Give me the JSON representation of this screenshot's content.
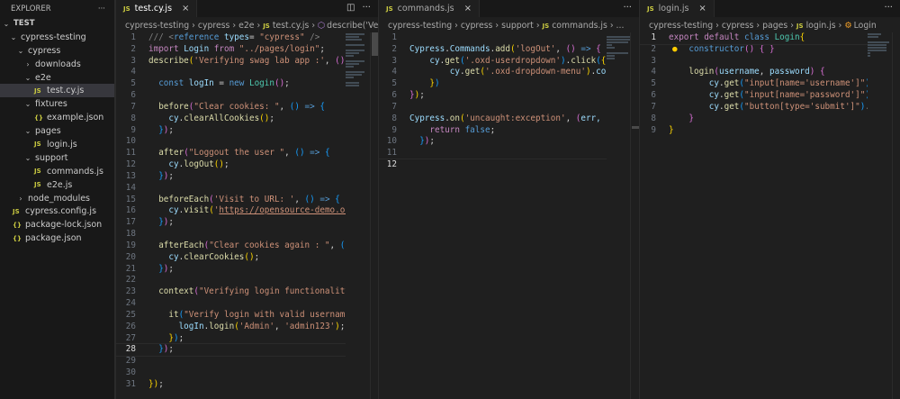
{
  "explorer": {
    "title": "EXPLORER",
    "more": "···",
    "items": [
      {
        "label": "TEST",
        "depth": 0,
        "type": "folder",
        "bold": true
      },
      {
        "label": "cypress-testing",
        "depth": 1,
        "type": "folder"
      },
      {
        "label": "cypress",
        "depth": 2,
        "type": "folder"
      },
      {
        "label": "downloads",
        "depth": 3,
        "type": "folder-closed"
      },
      {
        "label": "e2e",
        "depth": 3,
        "type": "folder"
      },
      {
        "label": "test.cy.js",
        "depth": 4,
        "type": "js",
        "selected": true
      },
      {
        "label": "fixtures",
        "depth": 3,
        "type": "folder"
      },
      {
        "label": "example.json",
        "depth": 4,
        "type": "json"
      },
      {
        "label": "pages",
        "depth": 3,
        "type": "folder"
      },
      {
        "label": "login.js",
        "depth": 4,
        "type": "js"
      },
      {
        "label": "support",
        "depth": 3,
        "type": "folder"
      },
      {
        "label": "commands.js",
        "depth": 4,
        "type": "js"
      },
      {
        "label": "e2e.js",
        "depth": 4,
        "type": "js"
      },
      {
        "label": "node_modules",
        "depth": 2,
        "type": "folder-closed"
      },
      {
        "label": "cypress.config.js",
        "depth": 1,
        "type": "js"
      },
      {
        "label": "package-lock.json",
        "depth": 1,
        "type": "json"
      },
      {
        "label": "package.json",
        "depth": 1,
        "type": "json"
      }
    ]
  },
  "icons": {
    "js": "JS",
    "json": "{}",
    "close": "×",
    "more": "···",
    "split": "◫",
    "chev_open": "⌄",
    "chev_closed": "›",
    "bulb": "💡"
  },
  "editors": [
    {
      "tab": "test.cy.js",
      "crumbs": [
        "cypress-testing",
        "cypress",
        "e2e",
        "test.cy.js",
        "describe('Verifying s"
      ],
      "active_line": 28,
      "lines": [
        [
          [
            "/// ",
            "cm"
          ],
          [
            "<",
            "cm"
          ],
          [
            "reference ",
            "key"
          ],
          [
            "types",
            "var"
          ],
          [
            "= ",
            "p"
          ],
          [
            "\"cypress\"",
            "str"
          ],
          [
            " />",
            "cm"
          ]
        ],
        [
          [
            "import ",
            "ctl"
          ],
          [
            "Login ",
            "var"
          ],
          [
            "from ",
            "ctl"
          ],
          [
            "\"../pages/login\"",
            "str"
          ],
          [
            ";",
            "p"
          ]
        ],
        [
          [
            "describe",
            "fn"
          ],
          [
            "(",
            "b1"
          ],
          [
            "'Verifying swag lab app :'",
            "str"
          ],
          [
            ", ",
            "p"
          ],
          [
            "()",
            "b2"
          ],
          [
            " ",
            "p"
          ]
        ],
        [],
        [
          [
            "  const ",
            "key"
          ],
          [
            "logIn",
            "var"
          ],
          [
            " = ",
            "p"
          ],
          [
            "new ",
            "key"
          ],
          [
            "Login",
            "cls"
          ],
          [
            "()",
            "b2"
          ],
          [
            ";",
            "p"
          ]
        ],
        [],
        [
          [
            "  before",
            "fn"
          ],
          [
            "(",
            "b2"
          ],
          [
            "\"Clear cookies: \"",
            "str"
          ],
          [
            ", ",
            "p"
          ],
          [
            "()",
            "b3"
          ],
          [
            " => ",
            "key"
          ],
          [
            "{",
            "b3"
          ]
        ],
        [
          [
            "    cy",
            "var"
          ],
          [
            ".",
            "p"
          ],
          [
            "clearAllCookies",
            "fn"
          ],
          [
            "()",
            "b1"
          ],
          [
            ";",
            "p"
          ]
        ],
        [
          [
            "  }",
            "b3"
          ],
          [
            ")",
            "b2"
          ],
          [
            ";",
            "p"
          ]
        ],
        [],
        [
          [
            "  after",
            "fn"
          ],
          [
            "(",
            "b2"
          ],
          [
            "\"Loggout the user \"",
            "str"
          ],
          [
            ", ",
            "p"
          ],
          [
            "()",
            "b3"
          ],
          [
            " => ",
            "key"
          ],
          [
            "{",
            "b3"
          ]
        ],
        [
          [
            "    cy",
            "var"
          ],
          [
            ".",
            "p"
          ],
          [
            "logOut",
            "fn"
          ],
          [
            "()",
            "b1"
          ],
          [
            ";",
            "p"
          ]
        ],
        [
          [
            "  }",
            "b3"
          ],
          [
            ")",
            "b2"
          ],
          [
            ";",
            "p"
          ]
        ],
        [],
        [
          [
            "  beforeEach",
            "fn"
          ],
          [
            "(",
            "b2"
          ],
          [
            "'Visit to URL: '",
            "str"
          ],
          [
            ", ",
            "p"
          ],
          [
            "()",
            "b3"
          ],
          [
            " => ",
            "key"
          ],
          [
            "{",
            "b3"
          ]
        ],
        [
          [
            "    cy",
            "var"
          ],
          [
            ".",
            "p"
          ],
          [
            "visit",
            "fn"
          ],
          [
            "(",
            "b1"
          ],
          [
            "'",
            "str"
          ],
          [
            "https://opensource-demo.or",
            "url"
          ]
        ],
        [
          [
            "  }",
            "b3"
          ],
          [
            ")",
            "b2"
          ],
          [
            ";",
            "p"
          ]
        ],
        [],
        [
          [
            "  afterEach",
            "fn"
          ],
          [
            "(",
            "b2"
          ],
          [
            "\"Clear cookies again : \"",
            "str"
          ],
          [
            ", ",
            "p"
          ],
          [
            "()",
            "b3"
          ]
        ],
        [
          [
            "    cy",
            "var"
          ],
          [
            ".",
            "p"
          ],
          [
            "clearCookies",
            "fn"
          ],
          [
            "()",
            "b1"
          ],
          [
            ";",
            "p"
          ]
        ],
        [
          [
            "  }",
            "b3"
          ],
          [
            ")",
            "b2"
          ],
          [
            ";",
            "p"
          ]
        ],
        [],
        [
          [
            "  context",
            "fn"
          ],
          [
            "(",
            "b2"
          ],
          [
            "\"Verifying login functionality",
            "str"
          ]
        ],
        [],
        [
          [
            "    it",
            "fn"
          ],
          [
            "(",
            "b3"
          ],
          [
            "\"Verify login with valid username",
            "str"
          ]
        ],
        [
          [
            "      logIn",
            "var"
          ],
          [
            ".",
            "p"
          ],
          [
            "login",
            "fn"
          ],
          [
            "(",
            "b1"
          ],
          [
            "'Admin'",
            "str"
          ],
          [
            ", ",
            "p"
          ],
          [
            "'admin123'",
            "str"
          ],
          [
            ")",
            "b1"
          ],
          [
            ";",
            "p"
          ]
        ],
        [
          [
            "    }",
            "b1"
          ],
          [
            ")",
            "b3"
          ],
          [
            ";",
            "p"
          ]
        ],
        [
          [
            "  }",
            "b3"
          ],
          [
            ")",
            "b2"
          ],
          [
            ";",
            "p"
          ]
        ],
        [],
        [],
        [
          [
            "}",
            "b1"
          ],
          [
            ")",
            "b1"
          ],
          [
            ";",
            "p"
          ]
        ]
      ]
    },
    {
      "tab": "commands.js",
      "crumbs": [
        "cypress-testing",
        "cypress",
        "support",
        "commands.js",
        "..."
      ],
      "active_line": 12,
      "lines": [
        [],
        [
          [
            "Cypress",
            "var"
          ],
          [
            ".",
            "p"
          ],
          [
            "Commands",
            "var"
          ],
          [
            ".",
            "p"
          ],
          [
            "add",
            "fn"
          ],
          [
            "(",
            "b1"
          ],
          [
            "'logOut'",
            "str"
          ],
          [
            ", ",
            "p"
          ],
          [
            "()",
            "b2"
          ],
          [
            " => ",
            "key"
          ],
          [
            "{",
            "b2"
          ]
        ],
        [
          [
            "    cy",
            "var"
          ],
          [
            ".",
            "p"
          ],
          [
            "get",
            "fn"
          ],
          [
            "(",
            "b3"
          ],
          [
            "'.oxd-userdropdown'",
            "str"
          ],
          [
            ")",
            "b3"
          ],
          [
            ".",
            "p"
          ],
          [
            "click",
            "fn"
          ],
          [
            "(",
            "b3"
          ],
          [
            "{",
            "b1"
          ],
          [
            "f",
            "var"
          ]
        ],
        [
          [
            "        cy",
            "var"
          ],
          [
            ".",
            "p"
          ],
          [
            "get",
            "fn"
          ],
          [
            "(",
            "b1"
          ],
          [
            "'.oxd-dropdown-menu'",
            "str"
          ],
          [
            ")",
            "b1"
          ],
          [
            ".",
            "p"
          ],
          [
            "con",
            "var"
          ]
        ],
        [
          [
            "    }",
            "b1"
          ],
          [
            ")",
            "b3"
          ]
        ],
        [
          [
            "}",
            "b2"
          ],
          [
            ")",
            "b1"
          ],
          [
            ";",
            "p"
          ]
        ],
        [],
        [
          [
            "Cypress",
            "var"
          ],
          [
            ".",
            "p"
          ],
          [
            "on",
            "fn"
          ],
          [
            "(",
            "b1"
          ],
          [
            "'uncaught:exception'",
            "str"
          ],
          [
            ", ",
            "p"
          ],
          [
            "(",
            "b2"
          ],
          [
            "err, r",
            "var"
          ]
        ],
        [
          [
            "    return ",
            "ctl"
          ],
          [
            "false",
            "key"
          ],
          [
            ";",
            "p"
          ]
        ],
        [
          [
            "  }",
            "b3"
          ],
          [
            ")",
            "b2"
          ],
          [
            ";",
            "p"
          ]
        ],
        [],
        []
      ]
    },
    {
      "tab": "login.js",
      "crumbs": [
        "cypress-testing",
        "cypress",
        "pages",
        "login.js",
        "Login"
      ],
      "active_line": 1,
      "lines": [
        [
          [
            "export ",
            "ctl"
          ],
          [
            "default ",
            "ctl"
          ],
          [
            "class ",
            "key"
          ],
          [
            "Login",
            "cls"
          ],
          [
            "{",
            "b1"
          ]
        ],
        [
          [
            "    constructor",
            "key"
          ],
          [
            "()",
            "b2"
          ],
          [
            " ",
            "p"
          ],
          [
            "{ }",
            "b2"
          ]
        ],
        [],
        [
          [
            "    login",
            "fn"
          ],
          [
            "(",
            "b2"
          ],
          [
            "username",
            "var"
          ],
          [
            ", ",
            "p"
          ],
          [
            "password",
            "var"
          ],
          [
            ")",
            "b2"
          ],
          [
            " ",
            "p"
          ],
          [
            "{",
            "b2"
          ]
        ],
        [
          [
            "        cy",
            "var"
          ],
          [
            ".",
            "p"
          ],
          [
            "get",
            "fn"
          ],
          [
            "(",
            "b3"
          ],
          [
            "\"input[name='username']\"",
            "str"
          ],
          [
            ")",
            "b3"
          ],
          [
            ".",
            "p"
          ]
        ],
        [
          [
            "        cy",
            "var"
          ],
          [
            ".",
            "p"
          ],
          [
            "get",
            "fn"
          ],
          [
            "(",
            "b3"
          ],
          [
            "\"input[name='password']\"",
            "str"
          ],
          [
            ")",
            "b3"
          ],
          [
            ".",
            "p"
          ]
        ],
        [
          [
            "        cy",
            "var"
          ],
          [
            ".",
            "p"
          ],
          [
            "get",
            "fn"
          ],
          [
            "(",
            "b3"
          ],
          [
            "\"button[type='submit']\"",
            "str"
          ],
          [
            ")",
            "b3"
          ],
          [
            ".",
            "p"
          ]
        ],
        [
          [
            "    }",
            "b2"
          ]
        ],
        [
          [
            "}",
            "b1"
          ]
        ]
      ]
    }
  ]
}
